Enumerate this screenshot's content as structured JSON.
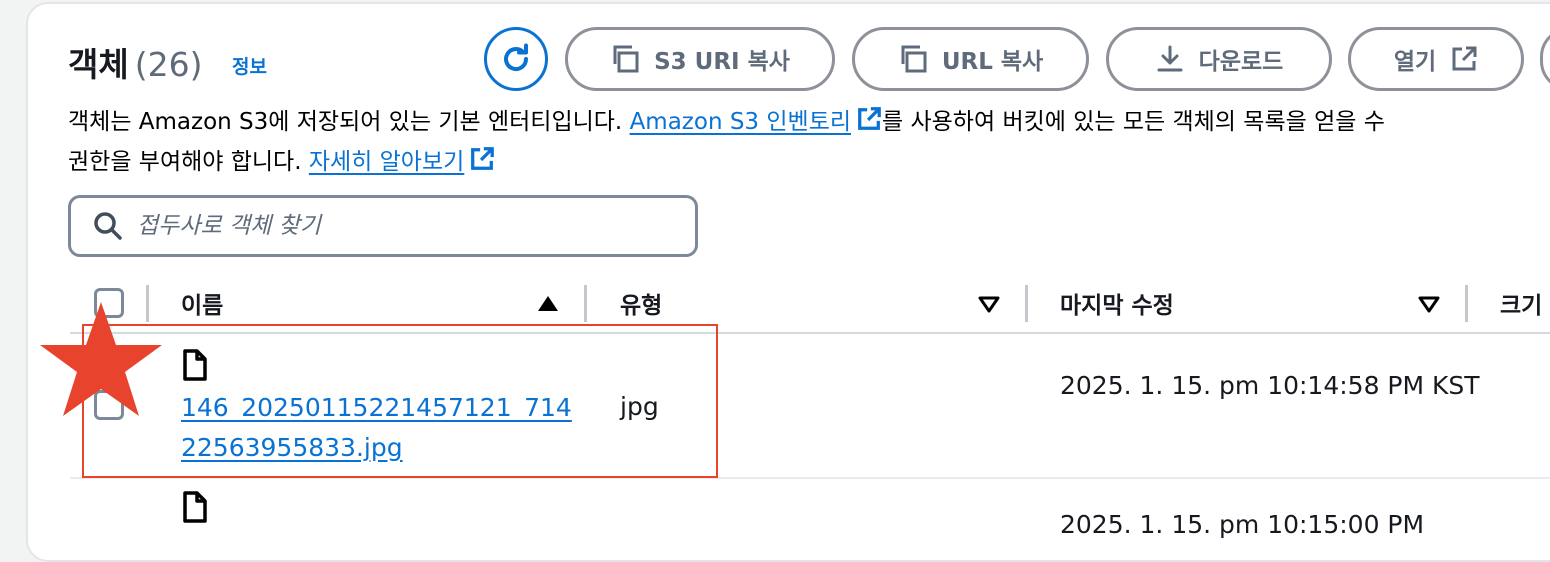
{
  "header": {
    "title": "객체",
    "count": "(26)",
    "info_link": "정보"
  },
  "toolbar": {
    "refresh_icon": "refresh-icon",
    "copy_s3_uri": "S3 URI 복사",
    "copy_url": "URL 복사",
    "download": "다운로드",
    "open": "열기"
  },
  "description": {
    "line1_text_a": "객체는 Amazon S3에 저장되어 있는 기본 엔터티입니다. ",
    "inventory_link": "Amazon S3 인벤토리",
    "line1_text_b": "를 사용하여 버킷에 있는 모든 객체의 목록을 얻을 수",
    "line2_text": "권한을 부여해야 합니다. ",
    "learn_more_link": "자세히 알아보기"
  },
  "search": {
    "placeholder": "접두사로 객체 찾기"
  },
  "table": {
    "columns": [
      "이름",
      "유형",
      "마지막 수정",
      "크기"
    ],
    "rows": [
      {
        "name": "146_20250115221457121_71422563955833.jpg",
        "type": "jpg",
        "last_modified": "2025. 1. 15. pm 10:14:58 PM KST"
      },
      {
        "last_modified_partial": "2025. 1. 15. pm 10:15:00 PM"
      }
    ]
  },
  "annotation": {
    "highlight_color": "#e8432c",
    "star_color": "#e8432c"
  },
  "colors": {
    "link": "#0972d3",
    "text": "#16191f",
    "muted": "#5f6b7a"
  }
}
